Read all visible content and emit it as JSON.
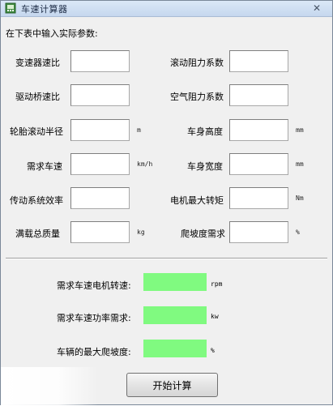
{
  "window": {
    "title": "车速计算器",
    "close_symbol": "✕"
  },
  "instruction": "在下表中输入实际参数:",
  "left_params": [
    {
      "label": "变速器速比",
      "value": "",
      "unit": ""
    },
    {
      "label": "驱动桥速比",
      "value": "",
      "unit": ""
    },
    {
      "label": "轮胎滚动半径",
      "value": "",
      "unit": "m"
    },
    {
      "label": "需求车速",
      "value": "",
      "unit": "km/h"
    },
    {
      "label": "传动系统效率",
      "value": "",
      "unit": ""
    },
    {
      "label": "满载总质量",
      "value": "",
      "unit": "kg"
    }
  ],
  "right_params": [
    {
      "label": "滚动阻力系数",
      "value": "",
      "unit": ""
    },
    {
      "label": "空气阻力系数",
      "value": "",
      "unit": ""
    },
    {
      "label": "车身高度",
      "value": "",
      "unit": "mm"
    },
    {
      "label": "车身宽度",
      "value": "",
      "unit": "mm"
    },
    {
      "label": "电机最大转矩",
      "value": "",
      "unit": "Nm"
    },
    {
      "label": "爬坡度需求",
      "value": "",
      "unit": "%"
    }
  ],
  "results": [
    {
      "label": "需求车速电机转速:",
      "value": "",
      "unit": "rpm"
    },
    {
      "label": "需求车速功率需求:",
      "value": "",
      "unit": "kw"
    },
    {
      "label": "车辆的最大爬坡度:",
      "value": "",
      "unit": "%"
    }
  ],
  "start_button": "开始计算",
  "colors": {
    "output_bg": "#80fa80",
    "window_bg": "#f0f0f0"
  },
  "icons": {
    "app": "window-app-icon",
    "close": "close-icon"
  }
}
